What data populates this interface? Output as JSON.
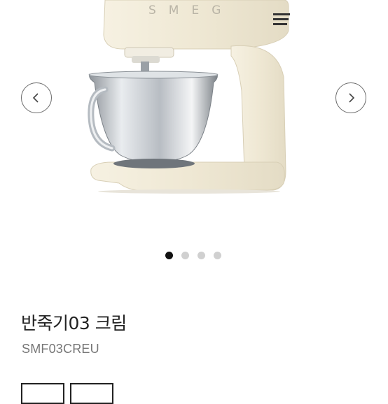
{
  "product": {
    "brand_logo_text": "SMEG",
    "name": "반죽기03 크림",
    "code": "SMF03CREU"
  },
  "carousel": {
    "slide_count": 4,
    "active_index": 0
  },
  "icons": {
    "prev": "chevron-left-icon",
    "next": "chevron-right-icon",
    "menu": "hamburger-menu-icon"
  },
  "colors": {
    "cream": "#efe8d6",
    "steel": "#c9cdd2",
    "dot_active": "#111111",
    "dot_inactive": "#d0d0d0"
  }
}
